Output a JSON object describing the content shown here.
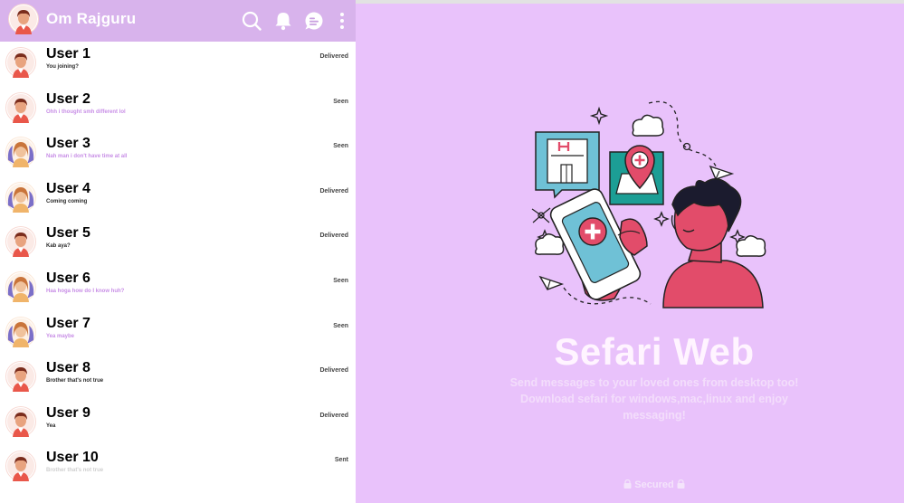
{
  "header": {
    "user_name": "Om Rajguru",
    "icons": [
      "search-icon",
      "bell-icon",
      "chat-icon",
      "more-vert-icon"
    ]
  },
  "chats": [
    {
      "name": "User 1",
      "message": "You joining?",
      "status": "Delivered",
      "avatar": "male"
    },
    {
      "name": "User 2",
      "message": "Ohh i thought smh different lol",
      "status": "Seen",
      "avatar": "male"
    },
    {
      "name": "User 3",
      "message": "Nah man i don't have time at all",
      "status": "Seen",
      "avatar": "female"
    },
    {
      "name": "User 4",
      "message": "Coming coming",
      "status": "Delivered",
      "avatar": "female"
    },
    {
      "name": "User 5",
      "message": "Kab aya?",
      "status": "Delivered",
      "avatar": "male"
    },
    {
      "name": "User 6",
      "message": "Haa hoga how do I know huh?",
      "status": "Seen",
      "avatar": "female"
    },
    {
      "name": "User 7",
      "message": "Yea maybe",
      "status": "Seen",
      "avatar": "female"
    },
    {
      "name": "User 8",
      "message": "Brother that's not true",
      "status": "Delivered",
      "avatar": "male"
    },
    {
      "name": "User 9",
      "message": "Yea",
      "status": "Delivered",
      "avatar": "male"
    },
    {
      "name": "User 10",
      "message": "Brother that's not true",
      "status": "Sent",
      "avatar": "male"
    }
  ],
  "welcome": {
    "title": "Sefari Web",
    "tagline": "Send messages to your loved ones from desktop too! Download sefari for windows,mac,linux and enjoy messaging!",
    "secured": "Secured"
  },
  "colors": {
    "header_bg": "#d8b3ec",
    "right_bg": "#e9c2fb",
    "seen_message": "#c88ee6",
    "accent_red": "#e24c6a",
    "accent_teal": "#1c9e95"
  }
}
